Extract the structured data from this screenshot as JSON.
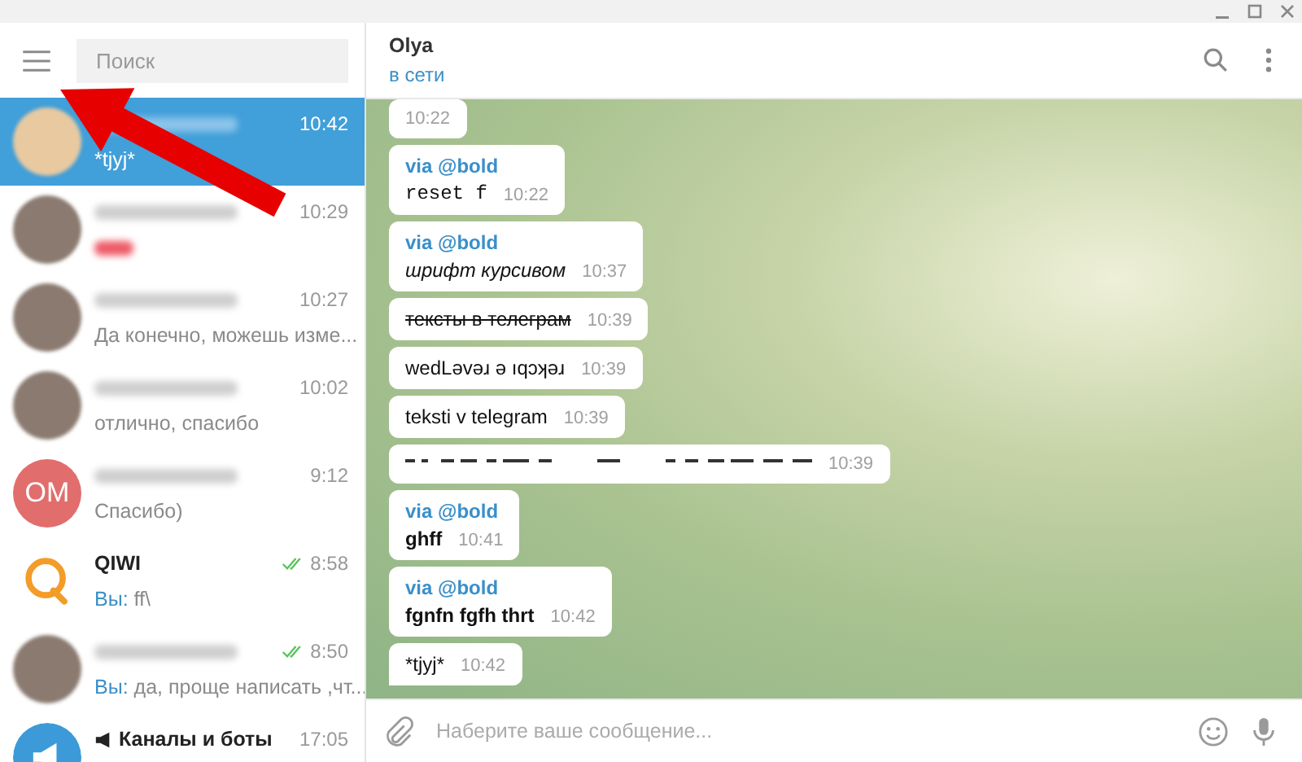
{
  "sidebar": {
    "search": {
      "placeholder": "Поиск"
    },
    "chats": [
      {
        "kind": "photo",
        "time": "10:42",
        "preview": "*tjyj*",
        "selected": true,
        "read": false
      },
      {
        "kind": "photo",
        "time": "10:29",
        "selected": false,
        "read": false
      },
      {
        "kind": "photo",
        "time": "10:27",
        "preview": "Да конечно, можешь изме...",
        "selected": false,
        "read": false
      },
      {
        "kind": "photo",
        "time": "10:02",
        "preview": "отлично, спасибо",
        "selected": false,
        "read": false
      },
      {
        "kind": "initials",
        "initials": "OM",
        "color": "#e26d6d",
        "time": "9:12",
        "preview": "Спасибо)",
        "selected": false,
        "read": false
      },
      {
        "kind": "logo",
        "name": "QIWI",
        "time": "8:58",
        "sender": "Вы:",
        "preview": "ff\\",
        "selected": false,
        "read": true
      },
      {
        "kind": "photo",
        "time": "8:50",
        "sender": "Вы:",
        "preview": "да, проще написать ,чт...",
        "selected": false,
        "read": true
      },
      {
        "kind": "channel",
        "name": "Каналы и боты",
        "channel": true,
        "time": "17:05",
        "selected": false,
        "read": false
      }
    ]
  },
  "chat": {
    "title": "Olya",
    "status": "в сети",
    "messages": [
      {
        "kind": "plain",
        "time": "10:22"
      },
      {
        "kind": "mono",
        "via": "via @bold",
        "text": "reset f",
        "time": "10:22"
      },
      {
        "kind": "italic",
        "via": "via @bold",
        "text": "шрифт курсивом",
        "time": "10:37"
      },
      {
        "kind": "strike",
        "text": "тексты в телеграм",
        "time": "10:39"
      },
      {
        "kind": "plain",
        "text": "wedLəvəɹ ə ıqɔʞəɹ",
        "time": "10:39"
      },
      {
        "kind": "plain",
        "text": "teksti v telegram",
        "time": "10:39"
      },
      {
        "kind": "garbled",
        "time": "10:39"
      },
      {
        "kind": "bold",
        "via": "via @bold",
        "text": "ghff",
        "time": "10:41"
      },
      {
        "kind": "bold",
        "via": "via @bold",
        "text": "fgnfn fgfh thrt",
        "time": "10:42"
      },
      {
        "kind": "plain",
        "text": "*tjyj*",
        "time": "10:42",
        "tail": true
      }
    ],
    "composer": {
      "placeholder": "Наберите ваше сообщение..."
    }
  }
}
